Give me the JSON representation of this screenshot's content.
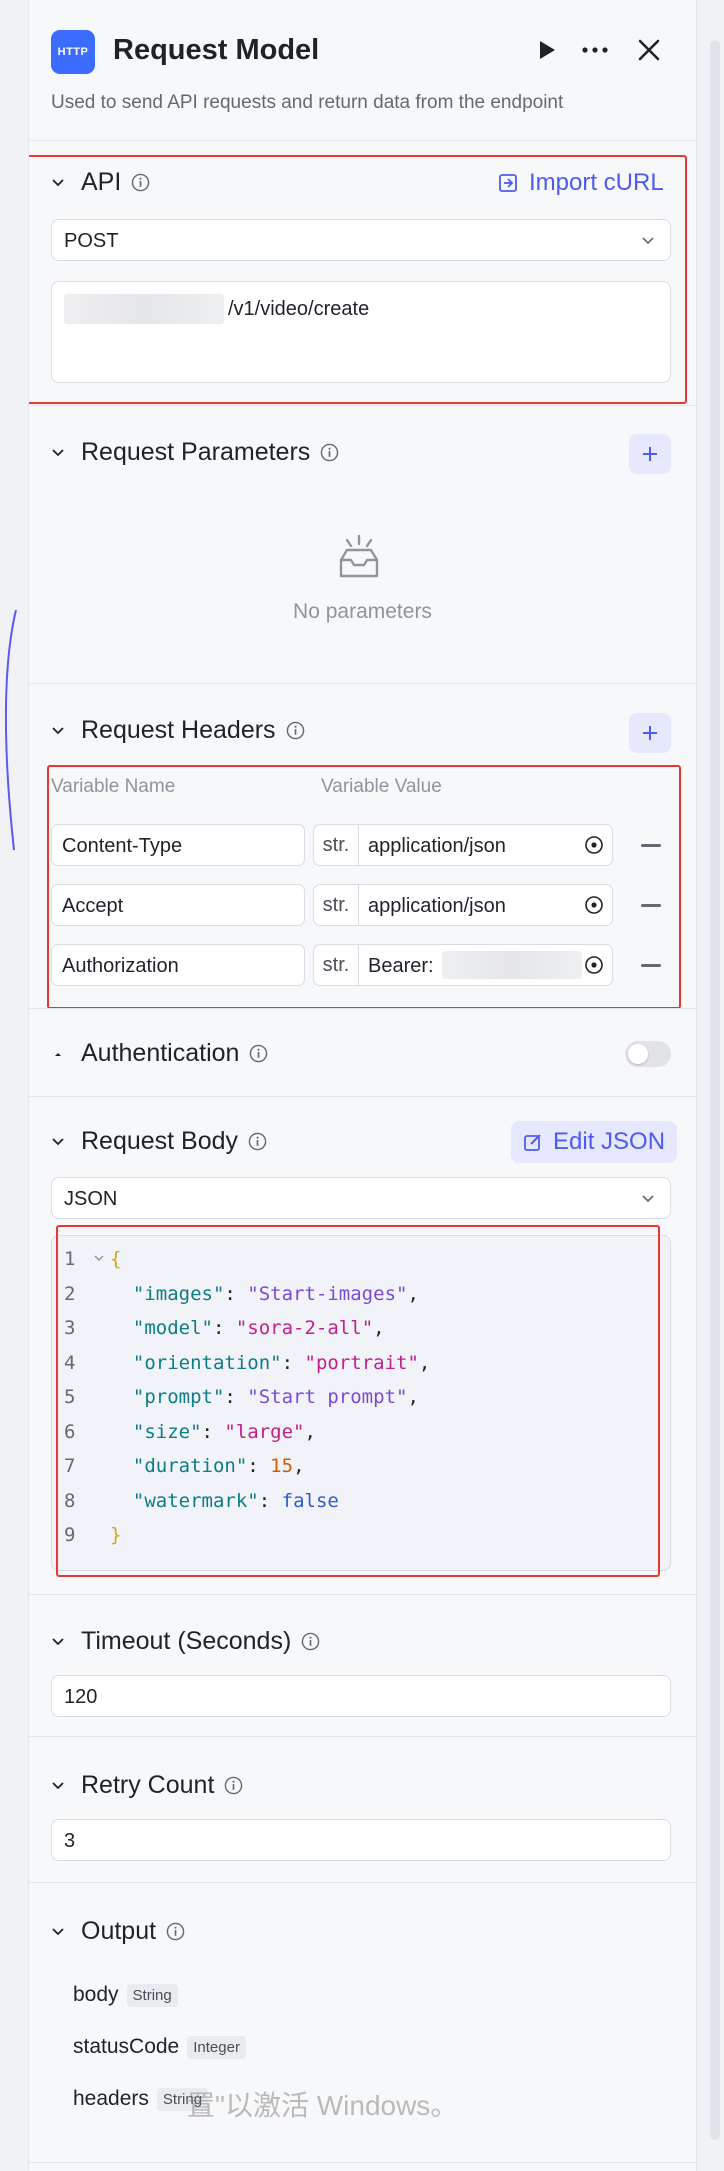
{
  "header": {
    "icon_text": "HTTP",
    "title": "Request Model",
    "description": "Used to send API requests and return data from the endpoint"
  },
  "api": {
    "title": "API",
    "import_label": "Import cURL",
    "method": "POST",
    "url": "/v1/video/create"
  },
  "params": {
    "title": "Request Parameters",
    "empty_text": "No parameters"
  },
  "headers": {
    "title": "Request Headers",
    "col_name": "Variable Name",
    "col_value": "Variable Value",
    "rows": [
      {
        "name": "Content-Type",
        "type": "str.",
        "value": "application/json"
      },
      {
        "name": "Accept",
        "type": "str.",
        "value": "application/json"
      },
      {
        "name": "Authorization",
        "type": "str.",
        "value": "Bearer:"
      }
    ]
  },
  "auth": {
    "title": "Authentication",
    "enabled": false
  },
  "body": {
    "title": "Request Body",
    "edit_label": "Edit JSON",
    "format": "JSON",
    "lines": [
      {
        "n": "1",
        "tokens": [
          {
            "t": "{",
            "c": "brace"
          }
        ]
      },
      {
        "n": "2",
        "tokens": [
          {
            "t": "  ",
            "c": "p"
          },
          {
            "t": "\"images\"",
            "c": "k"
          },
          {
            "t": ": ",
            "c": "p"
          },
          {
            "t": "\"Start-images\"",
            "c": "s"
          },
          {
            "t": ",",
            "c": "p"
          }
        ]
      },
      {
        "n": "3",
        "tokens": [
          {
            "t": "  ",
            "c": "p"
          },
          {
            "t": "\"model\"",
            "c": "k"
          },
          {
            "t": ": ",
            "c": "p"
          },
          {
            "t": "\"sora-2-all\"",
            "c": "s2"
          },
          {
            "t": ",",
            "c": "p"
          }
        ]
      },
      {
        "n": "4",
        "tokens": [
          {
            "t": "  ",
            "c": "p"
          },
          {
            "t": "\"orientation\"",
            "c": "k"
          },
          {
            "t": ": ",
            "c": "p"
          },
          {
            "t": "\"portrait\"",
            "c": "s2"
          },
          {
            "t": ",",
            "c": "p"
          }
        ]
      },
      {
        "n": "5",
        "tokens": [
          {
            "t": "  ",
            "c": "p"
          },
          {
            "t": "\"prompt\"",
            "c": "k"
          },
          {
            "t": ": ",
            "c": "p"
          },
          {
            "t": "\"Start prompt\"",
            "c": "s"
          },
          {
            "t": ",",
            "c": "p"
          }
        ]
      },
      {
        "n": "6",
        "tokens": [
          {
            "t": "  ",
            "c": "p"
          },
          {
            "t": "\"size\"",
            "c": "k"
          },
          {
            "t": ": ",
            "c": "p"
          },
          {
            "t": "\"large\"",
            "c": "s2"
          },
          {
            "t": ",",
            "c": "p"
          }
        ]
      },
      {
        "n": "7",
        "tokens": [
          {
            "t": "  ",
            "c": "p"
          },
          {
            "t": "\"duration\"",
            "c": "k"
          },
          {
            "t": ": ",
            "c": "p"
          },
          {
            "t": "15",
            "c": "n"
          },
          {
            "t": ",",
            "c": "p"
          }
        ]
      },
      {
        "n": "8",
        "tokens": [
          {
            "t": "  ",
            "c": "p"
          },
          {
            "t": "\"watermark\"",
            "c": "k"
          },
          {
            "t": ": ",
            "c": "p"
          },
          {
            "t": "false",
            "c": "b"
          }
        ]
      },
      {
        "n": "9",
        "tokens": [
          {
            "t": "}",
            "c": "brace"
          }
        ]
      }
    ]
  },
  "timeout": {
    "title": "Timeout (Seconds)",
    "value": "120"
  },
  "retry": {
    "title": "Retry Count",
    "value": "3"
  },
  "output": {
    "title": "Output",
    "items": [
      {
        "name": "body",
        "type": "String"
      },
      {
        "name": "statusCode",
        "type": "Integer"
      },
      {
        "name": "headers",
        "type": "String"
      }
    ]
  },
  "watermark_text": "置\"以激活 Windows。",
  "colors": {
    "accent": "#4e5bf2",
    "icon_bg": "#3b6cff",
    "highlight": "#e53935"
  }
}
